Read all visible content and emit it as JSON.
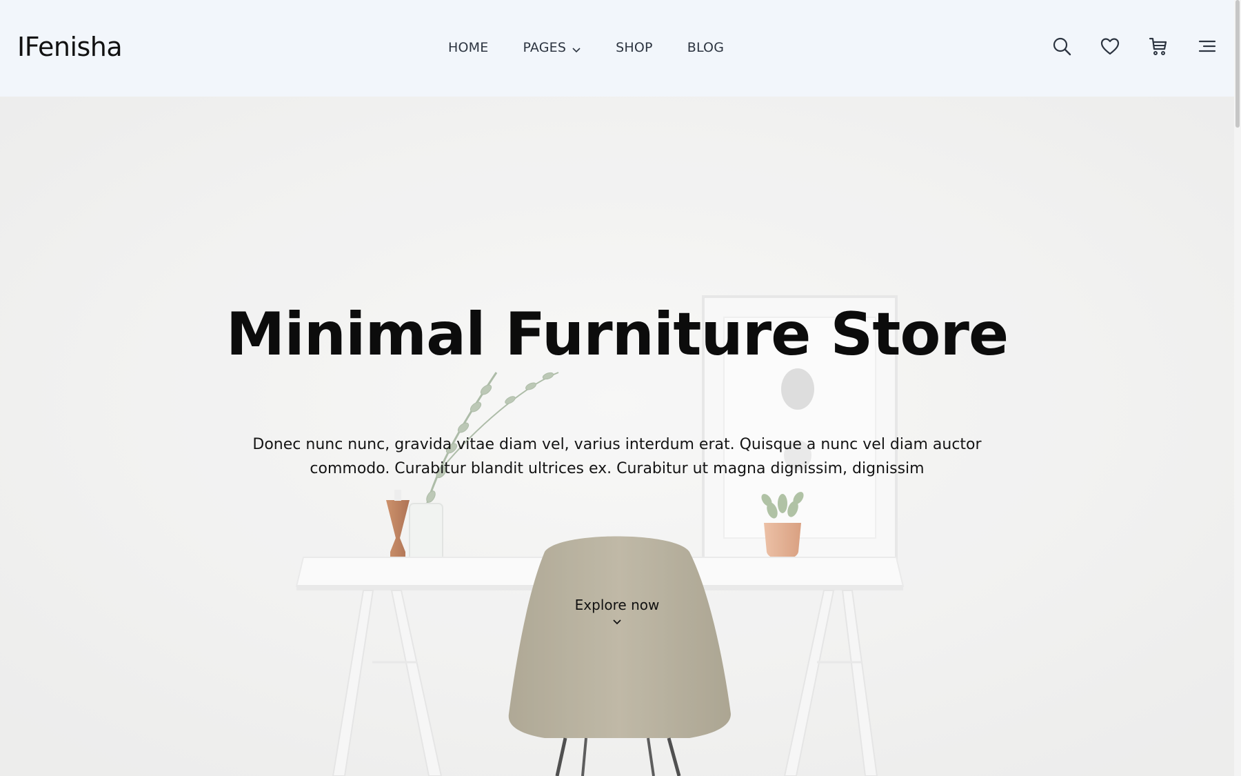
{
  "brand": {
    "logo_text": "IFenisha"
  },
  "nav": {
    "items": [
      {
        "label": "HOME",
        "has_dropdown": false
      },
      {
        "label": "PAGES",
        "has_dropdown": true
      },
      {
        "label": "SHOP",
        "has_dropdown": false
      },
      {
        "label": "BLOG",
        "has_dropdown": false
      }
    ]
  },
  "header_icons": [
    "search-icon",
    "heart-icon",
    "cart-icon",
    "menu-icon"
  ],
  "hero": {
    "title": "Minimal Furniture Store",
    "description": "Donec nunc nunc, gravida vitae diam vel, varius interdum erat. Quisque a nunc vel diam auctor commodo. Curabitur blandit ultrices ex. Curabitur ut magna dignissim, dignissim",
    "cta_label": "Explore now"
  },
  "colors": {
    "header_bg": "#f2f6fb",
    "text": "#111111",
    "chair": "#a9a08a",
    "vase": "#b56a3e"
  }
}
